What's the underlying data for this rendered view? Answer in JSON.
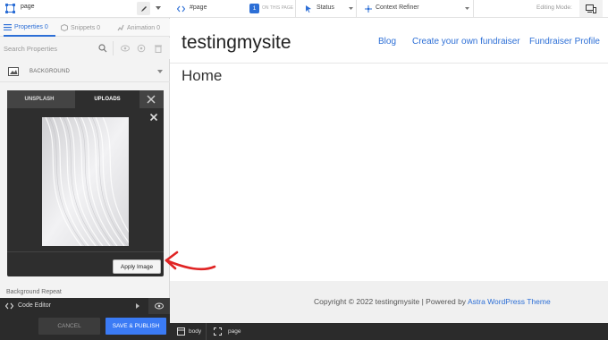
{
  "left_panel": {
    "selector": "page",
    "tabs": [
      {
        "label": "Properties 0"
      },
      {
        "label": "Snippets 0"
      },
      {
        "label": "Animation 0"
      }
    ],
    "search": {
      "placeholder": "Search Properties"
    },
    "background_row": {
      "label": "BACKGROUND"
    },
    "image_picker": {
      "tabs": [
        {
          "label": "UNSPLASH"
        },
        {
          "label": "UPLOADS"
        }
      ],
      "apply_label": "Apply Image"
    },
    "background_repeat_label": "Background Repeat",
    "code_editor_label": "Code Editor",
    "cancel_label": "CANCEL",
    "publish_label": "SAVE & PUBLISH"
  },
  "topbar": {
    "selector": "#page",
    "on_page_count": "1",
    "on_page_label": "ON THIS PAGE",
    "status_label": "Status",
    "context_refiner_label": "Context Refiner",
    "editing_mode_label": "Editing Mode:"
  },
  "site": {
    "title": "testingmysite",
    "nav": [
      {
        "label": "Blog"
      },
      {
        "label": "Create your own fundraiser"
      },
      {
        "label": "Fundraiser Profile"
      }
    ],
    "page_heading": "Home",
    "footer": {
      "text": "Copyright © 2022 testingmysite | Powered by ",
      "link": "Astra WordPress Theme"
    }
  },
  "bottombar": {
    "items": [
      {
        "label": "body"
      },
      {
        "label": "page"
      }
    ]
  },
  "colors": {
    "accent": "#2d6fd6",
    "publish": "#3b7bf5",
    "annotation": "#e02424"
  }
}
